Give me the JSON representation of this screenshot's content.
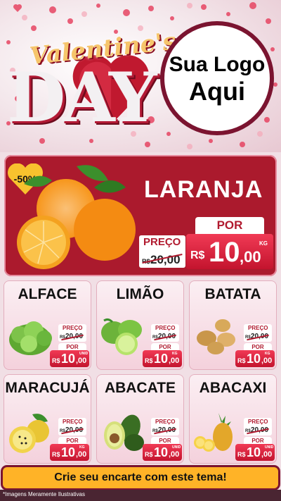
{
  "hero": {
    "title_script": "Valentine's",
    "title_block": "DAY",
    "logo_line1": "Sua Logo",
    "logo_line2": "Aqui"
  },
  "featured": {
    "discount_badge": "-50%",
    "name": "LARANJA",
    "preco_label": "PREÇO",
    "old_currency": "R$",
    "old_price": "20,00",
    "por_label": "POR",
    "new_currency": "R$",
    "new_price_int": "10",
    "new_price_dec": ",00",
    "unit": "KG"
  },
  "products": [
    {
      "name": "ALFACE",
      "preco_label": "PREÇO",
      "old_currency": "R$",
      "old_price": "20,00",
      "por_label": "POR",
      "new_currency": "R$",
      "new_price_int": "10",
      "new_price_dec": ",00",
      "unit": "UNID"
    },
    {
      "name": "LIMÃO",
      "preco_label": "PREÇO",
      "old_currency": "R$",
      "old_price": "20,00",
      "por_label": "POR",
      "new_currency": "R$",
      "new_price_int": "10",
      "new_price_dec": ",00",
      "unit": "KG"
    },
    {
      "name": "BATATA",
      "preco_label": "PREÇO",
      "old_currency": "R$",
      "old_price": "20,00",
      "por_label": "POR",
      "new_currency": "R$",
      "new_price_int": "10",
      "new_price_dec": ",00",
      "unit": "KG"
    },
    {
      "name": "MARACUJÁ",
      "preco_label": "PREÇO",
      "old_currency": "R$",
      "old_price": "20,00",
      "por_label": "POR",
      "new_currency": "R$",
      "new_price_int": "10",
      "new_price_dec": ",00",
      "unit": "KG"
    },
    {
      "name": "ABACATE",
      "preco_label": "PREÇO",
      "old_currency": "R$",
      "old_price": "20,00",
      "por_label": "POR",
      "new_currency": "R$",
      "new_price_int": "10",
      "new_price_dec": ",00",
      "unit": "UNID"
    },
    {
      "name": "ABACAXI",
      "preco_label": "PREÇO",
      "old_currency": "R$",
      "old_price": "20,00",
      "por_label": "POR",
      "new_currency": "R$",
      "new_price_int": "10",
      "new_price_dec": ",00",
      "unit": "UNID"
    }
  ],
  "cta": "Crie seu encarte com este tema!",
  "footer_note": "*Imagens Meramente Ilustrativas",
  "colors": {
    "brand_red": "#ab1a2d",
    "price_red": "#d41f39",
    "cta_yellow": "#ffb327",
    "dark_maroon": "#7b1430"
  }
}
